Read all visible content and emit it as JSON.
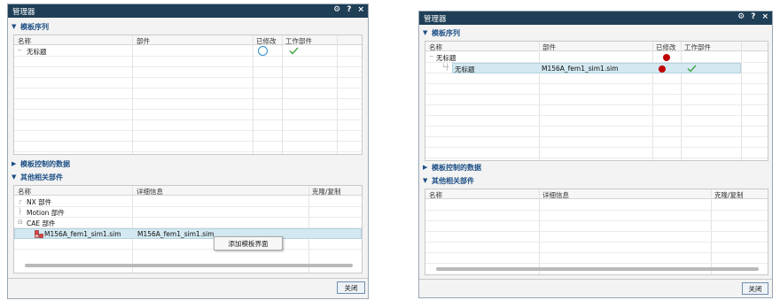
{
  "left": {
    "title": "管理器",
    "controls": [
      "⚙",
      "?",
      "×"
    ],
    "section1": "模板序列",
    "s1_cols": [
      "名称",
      "部件",
      "已修改",
      "工作部件"
    ],
    "s1_rows": [
      {
        "name": "无标题",
        "modified_icon": "circle-outline-icon",
        "work_icon": "check-icon"
      }
    ],
    "section2": "模板控制的数据",
    "section3": "其他相关部件",
    "s3_cols": [
      "名称",
      "详细信息",
      "克隆/复制"
    ],
    "s3_rows": [
      "NX 部件",
      "Motion 部件",
      "CAE 部件"
    ],
    "sim_name": "M156A_fem1_sim1.sim",
    "sim_detail": "M156A_fem1_sim1.sim",
    "context_menu": "添加模板界面",
    "close": "关闭"
  },
  "right": {
    "title": "管理器",
    "controls": [
      "⚙",
      "?",
      "×"
    ],
    "section1": "模板序列",
    "s1_cols": [
      "名称",
      "部件",
      "已修改",
      "工作部件"
    ],
    "s1_root": "无标题",
    "s1_child": {
      "name": "无标题",
      "part": "M156A_fem1_sim1.sim",
      "work_icon": "check-icon"
    },
    "section2": "模板控制的数据",
    "section3": "其他相关部件",
    "s3_cols": [
      "名称",
      "详细信息",
      "克隆/复制"
    ],
    "close": "关闭"
  },
  "colors": {
    "titlebar": "#1f3f57",
    "section_text": "#1d4f86",
    "modified_dot": "#c00000",
    "check": "#3aa13a",
    "selection": "#d3e8f0"
  }
}
